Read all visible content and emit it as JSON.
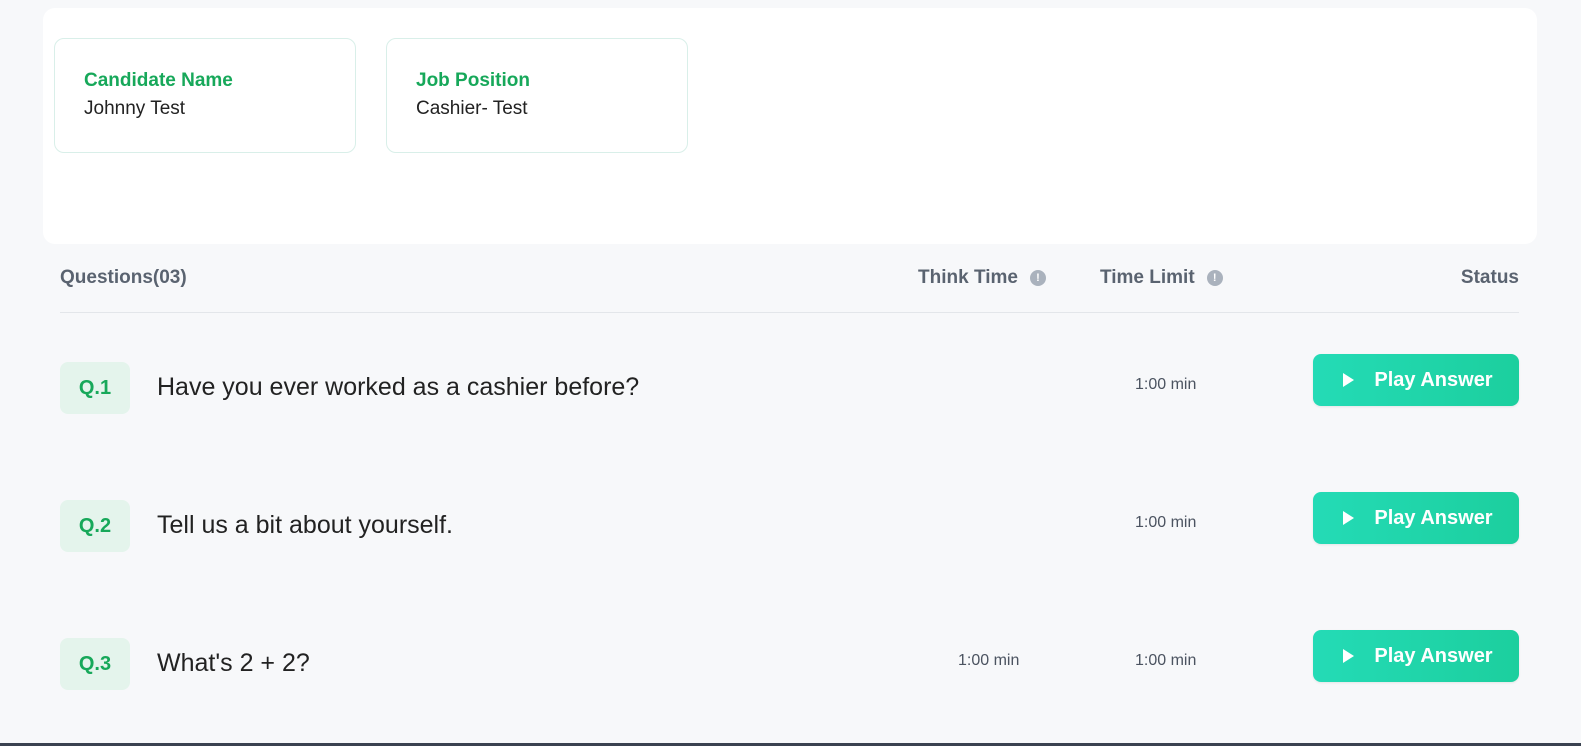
{
  "candidate": {
    "label": "Candidate Name",
    "value": "Johnny Test"
  },
  "job": {
    "label": "Job Position",
    "value": "Cashier- Test"
  },
  "table": {
    "questions_header": "Questions(03)",
    "think_time_header": "Think Time",
    "time_limit_header": "Time Limit",
    "status_header": "Status",
    "info_icon_glyph": "!"
  },
  "questions": [
    {
      "number": "Q.1",
      "text": "Have you ever worked as a cashier before?",
      "think_time": "",
      "time_limit": "1:00 min",
      "action_label": "Play Answer"
    },
    {
      "number": "Q.2",
      "text": "Tell us a bit about yourself.",
      "think_time": "",
      "time_limit": "1:00 min",
      "action_label": "Play Answer"
    },
    {
      "number": "Q.3",
      "text": "What's 2 + 2?",
      "think_time": "1:00 min",
      "time_limit": "1:00 min",
      "action_label": "Play Answer"
    }
  ],
  "colors": {
    "accent_green": "#17a85a",
    "button_gradient_start": "#24dbb6",
    "button_gradient_end": "#1ccf9e",
    "badge_bg": "#e4f4ec"
  },
  "icons": {
    "play": "play-icon",
    "info": "info-icon"
  }
}
